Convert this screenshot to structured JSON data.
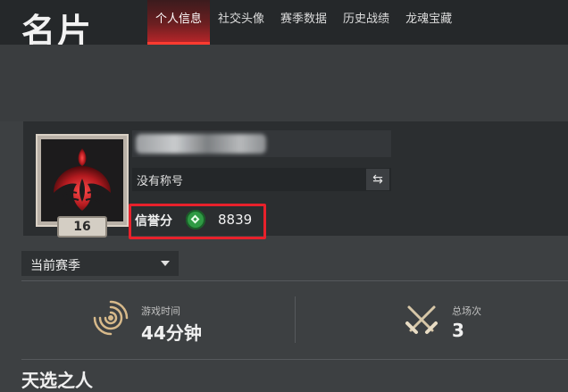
{
  "header": {
    "title": "名片",
    "tabs": [
      {
        "label": "个人信息",
        "active": true
      },
      {
        "label": "社交头像",
        "active": false
      },
      {
        "label": "赛季数据",
        "active": false
      },
      {
        "label": "历史战绩",
        "active": false
      },
      {
        "label": "龙魂宝藏",
        "active": false
      }
    ]
  },
  "profile": {
    "level": "16",
    "title_text": "没有称号",
    "credit_label": "信誉分",
    "credit_value": "8839"
  },
  "season": {
    "selected": "当前赛季"
  },
  "stats": {
    "play_time_label": "游戏时间",
    "play_time_value": "44分钟",
    "total_games_label": "总场次",
    "total_games_value": "3"
  },
  "section": {
    "heading": "天选之人"
  },
  "colors": {
    "accent": "#e8212b",
    "credit_icon": "#2f9a44",
    "gold": "#d7b98a"
  }
}
